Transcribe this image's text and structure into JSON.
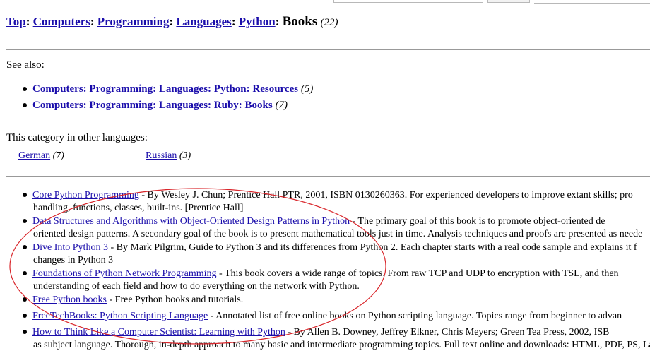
{
  "breadcrumb": {
    "links": [
      "Top",
      "Computers",
      "Programming",
      "Languages",
      "Python"
    ],
    "current": "Books",
    "count": "(22)"
  },
  "see_also": {
    "label": "See also:",
    "items": [
      {
        "link": "Computers: Programming: Languages: Python: Resources",
        "count": "(5)"
      },
      {
        "link": "Computers: Programming: Languages: Ruby: Books",
        "count": "(7)"
      }
    ]
  },
  "other_languages": {
    "label": "This category in other languages:",
    "items": [
      {
        "link": "German",
        "count": "(7)"
      },
      {
        "link": "Russian",
        "count": "(3)"
      }
    ]
  },
  "books": [
    {
      "title": "Core Python Programming",
      "desc": " - By Wesley J. Chun; Prentice Hall PTR, 2001, ISBN 0130260363. For experienced developers to improve extant skills; pro",
      "desc2": "handling, functions, classes, built-ins. [Prentice Hall]"
    },
    {
      "title": "Data Structures and Algorithms with Object-Oriented Design Patterns in Python",
      "desc": " - The primary goal of this book is to promote object-oriented de",
      "desc2": "oriented design patterns. A secondary goal of the book is to present mathematical tools just in time. Analysis techniques and proofs are presented as neede"
    },
    {
      "title": "Dive Into Python 3",
      "desc": " - By Mark Pilgrim, Guide to Python 3 and its differences from Python 2. Each chapter starts with a real code sample and explains it f",
      "desc2": "changes in Python 3"
    },
    {
      "title": "Foundations of Python Network Programming",
      "desc": " - This book covers a wide range of topics. From raw TCP and UDP to encryption with TSL, and then",
      "desc2": "understanding of each field and how to do everything on the network with Python."
    },
    {
      "title": "Free Python books",
      "desc": " - Free Python books and tutorials.",
      "desc2": ""
    },
    {
      "title": "FreeTechBooks: Python Scripting Language",
      "desc": " - Annotated list of free online books on Python scripting language. Topics range from beginner to advan",
      "desc2": ""
    },
    {
      "title": "How to Think Like a Computer Scientist: Learning with Python",
      "desc": " - By Allen B. Downey, Jeffrey Elkner, Chris Meyers; Green Tea Press, 2002, ISB",
      "desc2": "as subject language. Thorough, in-depth approach to many basic and intermediate programming topics. Full text online and downloads: HTML, PDF, PS, La"
    }
  ],
  "colors": {
    "link": "#1a0dab",
    "annotation": "#d9262b"
  }
}
